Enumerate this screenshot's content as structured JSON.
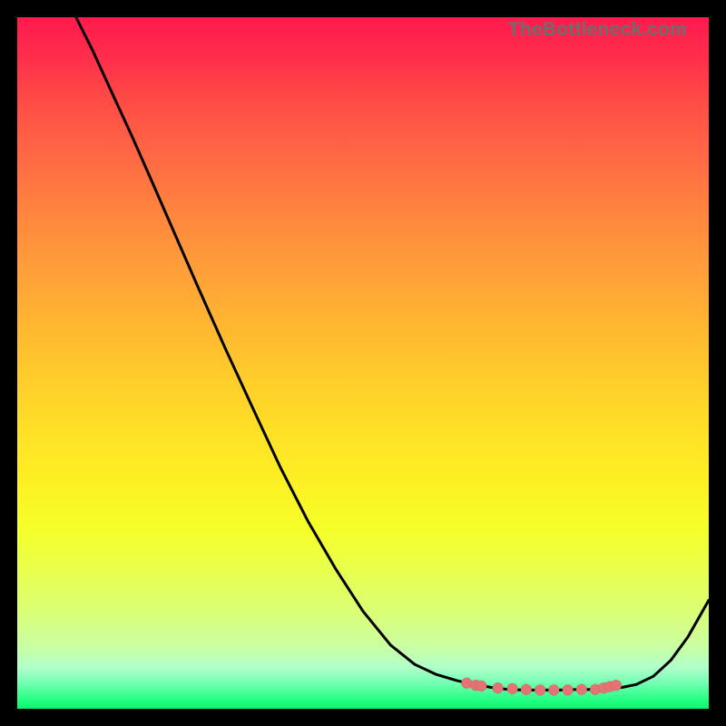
{
  "watermark": "TheBottleneck.com",
  "chart_data": {
    "type": "line",
    "title": "",
    "xlabel": "",
    "ylabel": "",
    "xlim": [
      0,
      1
    ],
    "ylim": [
      0,
      1
    ],
    "axes_visible": false,
    "grid": false,
    "background": "rainbow-gradient-vertical",
    "series": [
      {
        "name": "bottleneck-curve",
        "color": "#000000",
        "x": [
          0.0,
          0.02,
          0.04,
          0.06,
          0.085,
          0.11,
          0.135,
          0.165,
          0.195,
          0.225,
          0.26,
          0.3,
          0.34,
          0.38,
          0.42,
          0.46,
          0.5,
          0.54,
          0.575,
          0.605,
          0.635,
          0.66,
          0.685,
          0.71,
          0.735,
          0.76,
          0.785,
          0.81,
          0.833,
          0.855,
          0.875,
          0.895,
          0.92,
          0.945,
          0.97,
          1.0
        ],
        "y": [
          1.1,
          1.09,
          1.07,
          1.04,
          1.0,
          0.95,
          0.895,
          0.83,
          0.762,
          0.693,
          0.613,
          0.523,
          0.436,
          0.35,
          0.272,
          0.203,
          0.141,
          0.092,
          0.064,
          0.05,
          0.041,
          0.035,
          0.031,
          0.028,
          0.027,
          0.027,
          0.027,
          0.028,
          0.028,
          0.029,
          0.031,
          0.035,
          0.047,
          0.07,
          0.104,
          0.157
        ]
      }
    ],
    "points": {
      "name": "highlighted-fit-points",
      "color": "#e57373",
      "radius_px": 6,
      "x": [
        0.65,
        0.663,
        0.671,
        0.695,
        0.716,
        0.736,
        0.756,
        0.776,
        0.796,
        0.816,
        0.836,
        0.848,
        0.857,
        0.866
      ],
      "y": [
        0.037,
        0.034,
        0.033,
        0.03,
        0.029,
        0.028,
        0.027,
        0.027,
        0.027,
        0.028,
        0.028,
        0.03,
        0.032,
        0.034
      ]
    }
  }
}
